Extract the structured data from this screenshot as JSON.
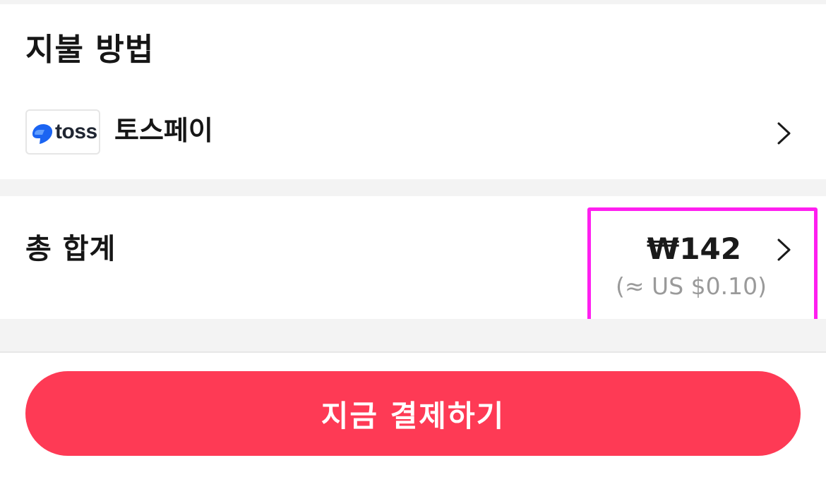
{
  "payment": {
    "title": "지불 방법",
    "method": {
      "logo_text": "toss",
      "label": "토스페이",
      "chevron_icon": "chevron-right-icon"
    }
  },
  "total": {
    "label": "총 합계",
    "amount": "₩142",
    "usd_equivalent": "(≈ US $0.10)",
    "chevron_icon": "chevron-right-icon",
    "highlight_color": "#ff1ff0"
  },
  "footer": {
    "pay_button_label": "지금 결제하기",
    "pay_button_color": "#fe3a55"
  },
  "colors": {
    "toss_blue": "#0064ff",
    "background_gray": "#f3f3f3"
  }
}
